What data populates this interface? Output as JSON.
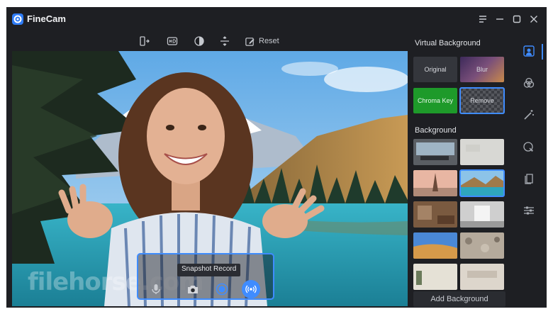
{
  "app": {
    "title": "FineCam",
    "colors": {
      "accent": "#3f8cff",
      "window_bg": "#1e1f23",
      "chroma": "#1e9a2a"
    }
  },
  "titlebar": {
    "buttons": [
      "menu-icon",
      "minimize-icon",
      "maximize-icon",
      "close-icon"
    ]
  },
  "toolbar": {
    "tools": [
      "mirror-icon",
      "hdr-icon",
      "contrast-icon",
      "flip-icon"
    ],
    "reset_label": "Reset"
  },
  "preview": {
    "watermark": "filehorse.com",
    "controls": {
      "tooltip": "Snapshot Record",
      "buttons": [
        "microphone-icon",
        "camera-icon",
        "record-icon",
        "broadcast-icon"
      ]
    }
  },
  "panel": {
    "virtual_background": {
      "title": "Virtual Background",
      "options": [
        {
          "label": "Original"
        },
        {
          "label": "Blur"
        },
        {
          "label": "Chroma Key"
        },
        {
          "label": "Remove",
          "selected": true
        }
      ]
    },
    "background": {
      "title": "Background",
      "thumbnails": [
        "office",
        "plaster-wall",
        "paris",
        "mountain-lake",
        "living-room",
        "white-room",
        "desert",
        "pebbles",
        "plain-room",
        "sign-wall"
      ],
      "selected": "mountain-lake"
    },
    "add_label": "Add Background"
  },
  "rail": {
    "items": [
      "person-icon",
      "filter-icon",
      "magic-wand-icon",
      "sticker-icon",
      "document-icon",
      "sliders-icon"
    ],
    "active": "person-icon"
  }
}
